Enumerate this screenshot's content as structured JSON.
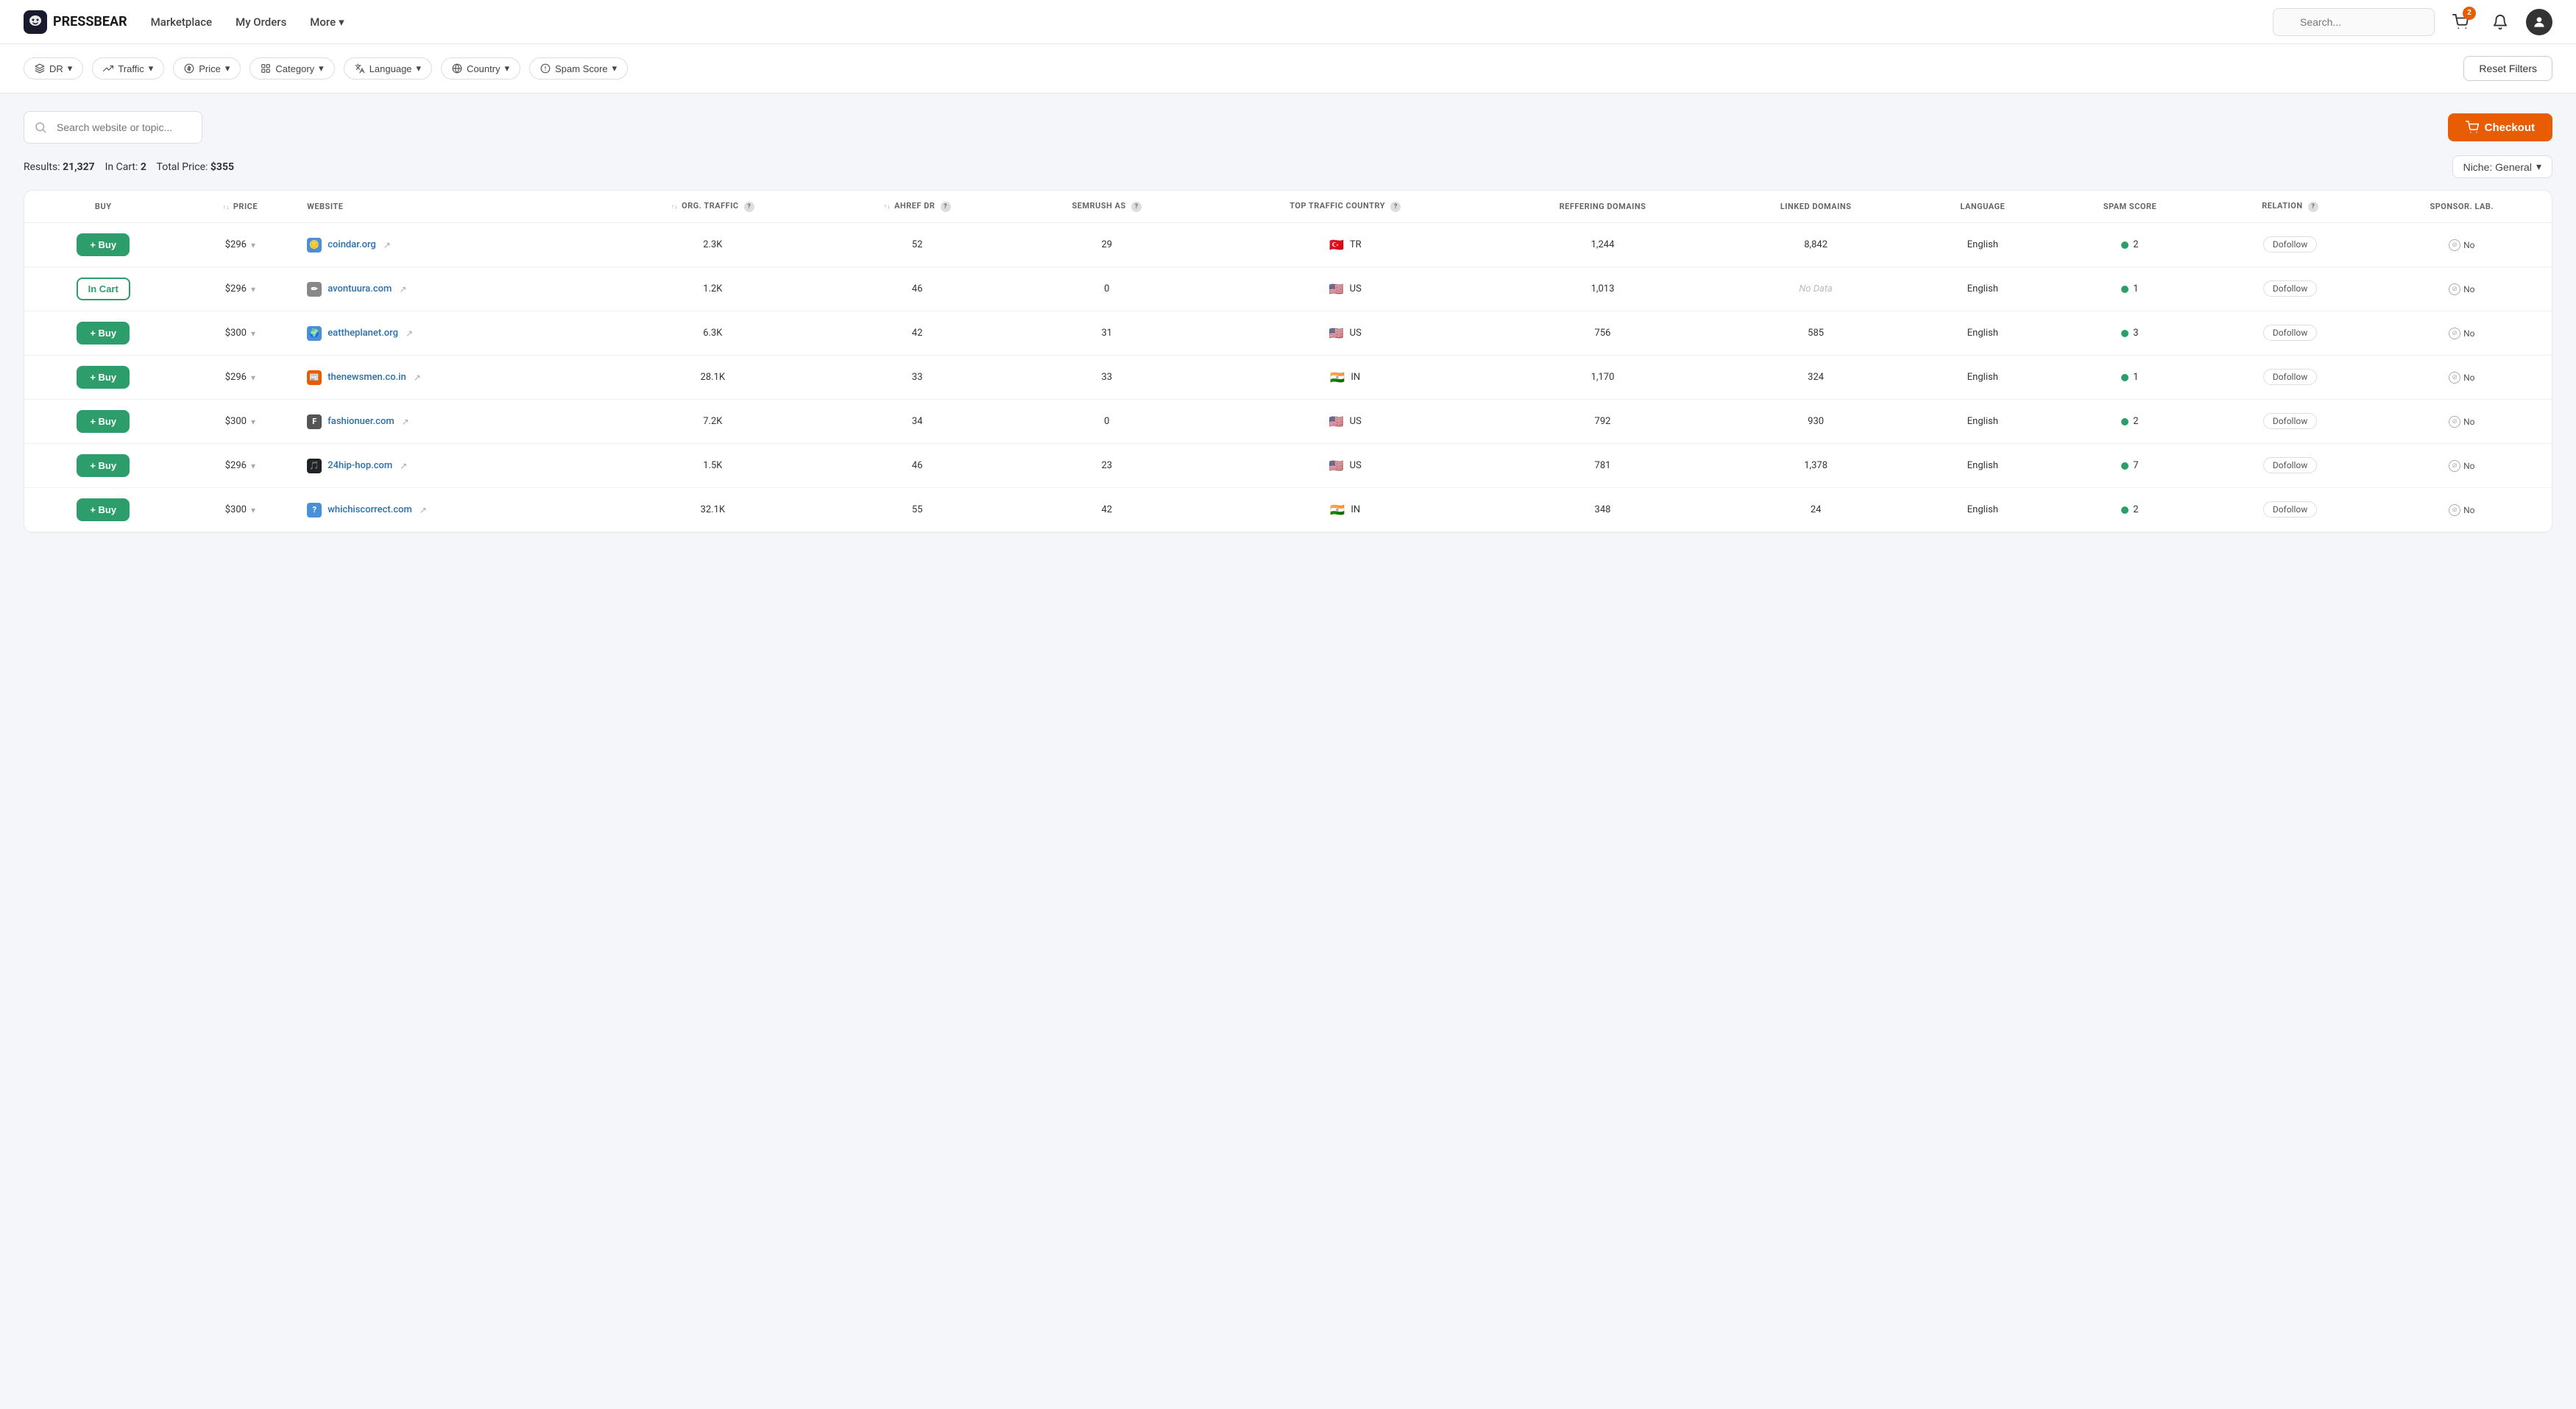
{
  "header": {
    "logo_text": "PRESSBEAR",
    "nav": [
      {
        "label": "Marketplace",
        "id": "marketplace"
      },
      {
        "label": "My Orders",
        "id": "my-orders"
      },
      {
        "label": "More",
        "id": "more",
        "has_dropdown": true
      }
    ],
    "search_placeholder": "Search...",
    "cart_badge": "2"
  },
  "filters": {
    "buttons": [
      {
        "id": "dr",
        "label": "DR",
        "icon": "dr"
      },
      {
        "id": "traffic",
        "label": "Traffic",
        "icon": "traffic"
      },
      {
        "id": "price",
        "label": "Price",
        "icon": "price"
      },
      {
        "id": "category",
        "label": "Category",
        "icon": "category"
      },
      {
        "id": "language",
        "label": "Language",
        "icon": "language"
      },
      {
        "id": "country",
        "label": "Country",
        "icon": "country"
      },
      {
        "id": "spam_score",
        "label": "Spam Score",
        "icon": "spam"
      }
    ],
    "reset_label": "Reset Filters"
  },
  "main": {
    "search_placeholder": "Search website or topic...",
    "checkout_label": "Checkout",
    "results_prefix": "Results: ",
    "results_count": "21,327",
    "cart_prefix": "In Cart: ",
    "cart_count": "2",
    "total_prefix": "Total Price: ",
    "total_price": "$355",
    "niche_label": "Niche: General"
  },
  "table": {
    "headers": [
      {
        "id": "buy",
        "label": "BUY",
        "sortable": false,
        "info": false
      },
      {
        "id": "price",
        "label": "PRICE",
        "sortable": true,
        "info": false
      },
      {
        "id": "website",
        "label": "WEBSITE",
        "sortable": false,
        "info": false
      },
      {
        "id": "org_traffic",
        "label": "ORG. TRAFFIC",
        "sortable": true,
        "info": true
      },
      {
        "id": "ahref_dr",
        "label": "AHREF DR",
        "sortable": true,
        "info": true
      },
      {
        "id": "semrush_as",
        "label": "SEMRUSH AS",
        "sortable": false,
        "info": true
      },
      {
        "id": "top_traffic_country",
        "label": "TOP TRAFFIC COUNTRY",
        "sortable": false,
        "info": true
      },
      {
        "id": "reffering_domains",
        "label": "REFFERING DOMAINS",
        "sortable": false,
        "info": false
      },
      {
        "id": "linked_domains",
        "label": "LINKED DOMAINS",
        "sortable": false,
        "info": false
      },
      {
        "id": "language",
        "label": "LANGUAGE",
        "sortable": false,
        "info": false
      },
      {
        "id": "spam_score",
        "label": "SPAM SCORE",
        "sortable": false,
        "info": false
      },
      {
        "id": "relation",
        "label": "RELATION",
        "sortable": false,
        "info": true
      },
      {
        "id": "sponsored_label",
        "label": "SPONSOR. LAB.",
        "sortable": false,
        "info": false
      }
    ],
    "rows": [
      {
        "id": 1,
        "buy_label": "+ Buy",
        "in_cart": false,
        "price": "$296",
        "website": "coindar.org",
        "website_icon": "🪙",
        "icon_color": "#4a90d9",
        "org_traffic": "2.3K",
        "ahref_dr": "52",
        "semrush_as": "29",
        "top_country": "TR",
        "top_country_flag": "🇹🇷",
        "reffering_domains": "1,244",
        "linked_domains": "8,842",
        "language": "English",
        "spam_score": "2",
        "spam_dot_color": "#2d9e6b",
        "relation": "Dofollow",
        "sponsored": "No"
      },
      {
        "id": 2,
        "buy_label": "In Cart",
        "in_cart": true,
        "price": "$296",
        "website": "avontuura.com",
        "website_icon": "✏",
        "icon_color": "#888",
        "org_traffic": "1.2K",
        "ahref_dr": "46",
        "semrush_as": "0",
        "top_country": "US",
        "top_country_flag": "🇺🇸",
        "reffering_domains": "1,013",
        "linked_domains": "No Data",
        "language": "English",
        "spam_score": "1",
        "spam_dot_color": "#2d9e6b",
        "relation": "Dofollow",
        "sponsored": "No"
      },
      {
        "id": 3,
        "buy_label": "+ Buy",
        "in_cart": false,
        "price": "$300",
        "website": "eattheplanet.org",
        "website_icon": "🌍",
        "icon_color": "#4a90d9",
        "org_traffic": "6.3K",
        "ahref_dr": "42",
        "semrush_as": "31",
        "top_country": "US",
        "top_country_flag": "🇺🇸",
        "reffering_domains": "756",
        "linked_domains": "585",
        "language": "English",
        "spam_score": "3",
        "spam_dot_color": "#2d9e6b",
        "relation": "Dofollow",
        "sponsored": "No"
      },
      {
        "id": 4,
        "buy_label": "+ Buy",
        "in_cart": false,
        "price": "$296",
        "website": "thenewsmen.co.in",
        "website_icon": "📰",
        "icon_color": "#e85d04",
        "org_traffic": "28.1K",
        "ahref_dr": "33",
        "semrush_as": "33",
        "top_country": "IN",
        "top_country_flag": "🇮🇳",
        "reffering_domains": "1,170",
        "linked_domains": "324",
        "language": "English",
        "spam_score": "1",
        "spam_dot_color": "#2d9e6b",
        "relation": "Dofollow",
        "sponsored": "No"
      },
      {
        "id": 5,
        "buy_label": "+ Buy",
        "in_cart": false,
        "price": "$300",
        "website": "fashionuer.com",
        "website_icon": "F",
        "icon_color": "#555",
        "org_traffic": "7.2K",
        "ahref_dr": "34",
        "semrush_as": "0",
        "top_country": "US",
        "top_country_flag": "🇺🇸",
        "reffering_domains": "792",
        "linked_domains": "930",
        "language": "English",
        "spam_score": "2",
        "spam_dot_color": "#2d9e6b",
        "relation": "Dofollow",
        "sponsored": "No"
      },
      {
        "id": 6,
        "buy_label": "+ Buy",
        "in_cart": false,
        "price": "$296",
        "website": "24hip-hop.com",
        "website_icon": "🎵",
        "icon_color": "#222",
        "org_traffic": "1.5K",
        "ahref_dr": "46",
        "semrush_as": "23",
        "top_country": "US",
        "top_country_flag": "🇺🇸",
        "reffering_domains": "781",
        "linked_domains": "1,378",
        "language": "English",
        "spam_score": "7",
        "spam_dot_color": "#2d9e6b",
        "relation": "Dofollow",
        "sponsored": "No"
      },
      {
        "id": 7,
        "buy_label": "+ Buy",
        "in_cart": false,
        "price": "$300",
        "website": "whichiscorrect.com",
        "website_icon": "?",
        "icon_color": "#4a90d9",
        "org_traffic": "32.1K",
        "ahref_dr": "55",
        "semrush_as": "42",
        "top_country": "IN",
        "top_country_flag": "🇮🇳",
        "reffering_domains": "348",
        "linked_domains": "24",
        "language": "English",
        "spam_score": "2",
        "spam_dot_color": "#2d9e6b",
        "relation": "Dofollow",
        "sponsored": "No"
      }
    ]
  }
}
